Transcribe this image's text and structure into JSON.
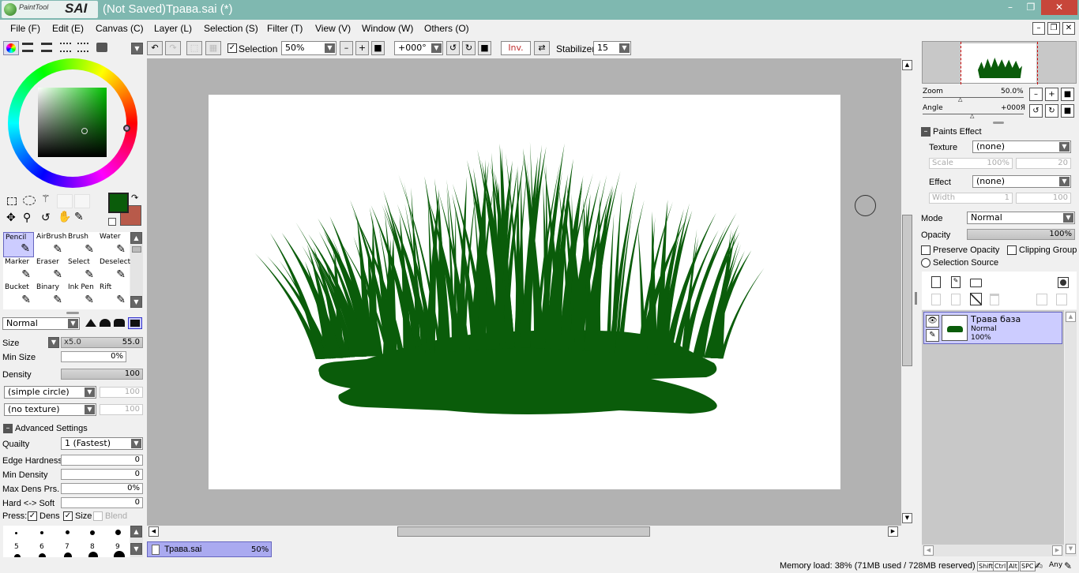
{
  "app": {
    "logo_small": "PaintTool",
    "logo_big": "SAI",
    "title": "(Not Saved)Трава.sai (*)"
  },
  "window_buttons": {
    "minimize": "–",
    "maximize": "❐",
    "close": "✕"
  },
  "menu": [
    "File (F)",
    "Edit (E)",
    "Canvas (C)",
    "Layer (L)",
    "Selection (S)",
    "Filter (T)",
    "View (V)",
    "Window (W)",
    "Others (O)"
  ],
  "toolbar": {
    "selection_label": "Selection",
    "zoom": "50%",
    "angle": "+000°",
    "invert": "Inv.",
    "stabilizer_label": "Stabilizer",
    "stabilizer_value": "15"
  },
  "tools": [
    {
      "label": "Pencil",
      "icon": "pencil-icon"
    },
    {
      "label": "AirBrush",
      "icon": "airbrush-icon"
    },
    {
      "label": "Brush",
      "icon": "brush-icon"
    },
    {
      "label": "Water",
      "icon": "water-icon"
    },
    {
      "label": "Marker",
      "icon": "marker-icon"
    },
    {
      "label": "Eraser",
      "icon": "eraser-icon"
    },
    {
      "label": "Select",
      "icon": "select-icon"
    },
    {
      "label": "Deselect",
      "icon": "deselect-icon"
    },
    {
      "label": "Bucket",
      "icon": "bucket-icon"
    },
    {
      "label": "Binary",
      "icon": "binary-icon"
    },
    {
      "label": "Ink Pen",
      "icon": "inkpen-icon"
    },
    {
      "label": "Rift",
      "icon": "rift-icon"
    }
  ],
  "colors": {
    "primary": "#0a5c0a",
    "secondary": "#b85a4a",
    "grass": "#0a5c0a",
    "selected_tool_bg": "#ccccff",
    "tab_bg": "#aaaaf0"
  },
  "brush": {
    "blend_mode": "Normal",
    "size_label": "Size",
    "size_mult": "x5.0",
    "size_value": "55.0",
    "min_size_label": "Min Size",
    "min_size_value": "0%",
    "density_label": "Density",
    "density_value": "100",
    "density_fill": 1.0,
    "shape": "(simple circle)",
    "shape_value": "100",
    "texture": "(no texture)",
    "texture_value": "100",
    "advanced_label": "Advanced Settings",
    "quality_label": "Quailty",
    "quality_value": "1 (Fastest)",
    "edge_label": "Edge Hardness",
    "edge_value": "0",
    "min_density_label": "Min Density",
    "min_density_value": "0",
    "max_dens_label": "Max Dens Prs.",
    "max_dens_value": "0%",
    "hard_soft_label": "Hard <-> Soft",
    "hard_soft_value": "0",
    "press_label": "Press:",
    "press_dens": "Dens",
    "press_size": "Size",
    "press_blend": "Blend",
    "sizes": [
      "5",
      "6",
      "7",
      "8",
      "9"
    ]
  },
  "navigator": {
    "zoom_label": "Zoom",
    "zoom_value": "50.0%",
    "angle_label": "Angle",
    "angle_value": "+000Я"
  },
  "paints_effect": {
    "header": "Paints Effect",
    "texture_label": "Texture",
    "texture_value": "(none)",
    "scale_label": "Scale",
    "scale_value": "100%",
    "scale_num": "20",
    "effect_label": "Effect",
    "effect_value": "(none)",
    "width_label": "Width",
    "width_value": "1",
    "width_num": "100"
  },
  "layer_props": {
    "mode_label": "Mode",
    "mode_value": "Normal",
    "opacity_label": "Opacity",
    "opacity_value": "100%",
    "preserve": "Preserve Opacity",
    "clipping": "Clipping Group",
    "selection_source": "Selection Source"
  },
  "layers": [
    {
      "name": "Трава база",
      "mode": "Normal",
      "opacity": "100%"
    }
  ],
  "doc_tab": {
    "name": "Трава.sai",
    "zoom": "50%"
  },
  "status": {
    "memory": "Memory load: 38% (71MB used / 728MB reserved)",
    "keys": [
      "Shift",
      "Ctrl",
      "Alt",
      "SPC"
    ],
    "any": "Any"
  }
}
